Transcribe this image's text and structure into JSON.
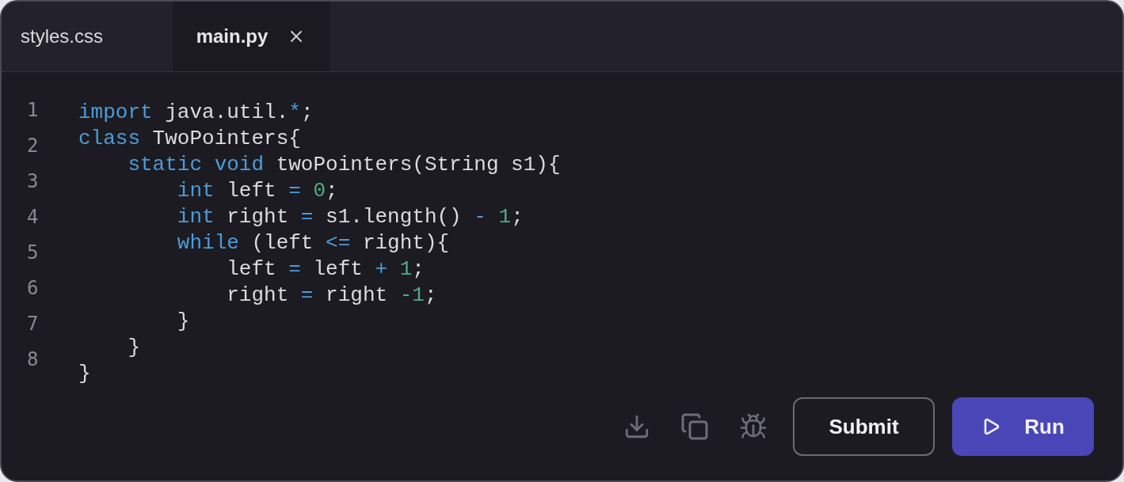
{
  "tabs": [
    {
      "label": "styles.css",
      "selected": false
    },
    {
      "label": "main.py",
      "selected": true
    }
  ],
  "line_numbers": [
    "1",
    "2",
    "3",
    "4",
    "5",
    "6",
    "7",
    "8"
  ],
  "code_lines": [
    [
      {
        "kind": "kw",
        "text": "import"
      },
      {
        "kind": "plain",
        "text": " java.util."
      },
      {
        "kind": "op",
        "text": "*"
      },
      {
        "kind": "plain",
        "text": ";"
      }
    ],
    [
      {
        "kind": "kw",
        "text": "class"
      },
      {
        "kind": "plain",
        "text": " TwoPointers{"
      }
    ],
    [
      {
        "kind": "kw",
        "text": "    static void"
      },
      {
        "kind": "plain",
        "text": " twoPointers(String s1){"
      }
    ],
    [
      {
        "kind": "kw",
        "text": "        int"
      },
      {
        "kind": "plain",
        "text": " left "
      },
      {
        "kind": "op",
        "text": "="
      },
      {
        "kind": "num",
        "text": " 0"
      },
      {
        "kind": "plain",
        "text": ";"
      }
    ],
    [
      {
        "kind": "kw",
        "text": "        int"
      },
      {
        "kind": "plain",
        "text": " right "
      },
      {
        "kind": "op",
        "text": "="
      },
      {
        "kind": "plain",
        "text": " s1.length() "
      },
      {
        "kind": "op",
        "text": "-"
      },
      {
        "kind": "num",
        "text": " 1"
      },
      {
        "kind": "plain",
        "text": ";"
      }
    ],
    [
      {
        "kind": "kw",
        "text": "        while"
      },
      {
        "kind": "plain",
        "text": " (left "
      },
      {
        "kind": "op",
        "text": "<="
      },
      {
        "kind": "plain",
        "text": " right){"
      }
    ],
    [
      {
        "kind": "plain",
        "text": "            left "
      },
      {
        "kind": "op",
        "text": "="
      },
      {
        "kind": "plain",
        "text": " left "
      },
      {
        "kind": "op",
        "text": "+"
      },
      {
        "kind": "num",
        "text": " 1"
      },
      {
        "kind": "plain",
        "text": ";"
      }
    ],
    [
      {
        "kind": "plain",
        "text": "            right "
      },
      {
        "kind": "op",
        "text": "="
      },
      {
        "kind": "plain",
        "text": " right "
      },
      {
        "kind": "num",
        "text": "-1"
      },
      {
        "kind": "plain",
        "text": ";"
      }
    ],
    [
      {
        "kind": "plain",
        "text": "        }"
      }
    ],
    [
      {
        "kind": "plain",
        "text": "    }"
      }
    ],
    [
      {
        "kind": "plain",
        "text": "}"
      }
    ]
  ],
  "buttons": [
    {
      "label": "Submit",
      "kind": "outline"
    },
    {
      "label": "Run",
      "kind": "primary"
    }
  ]
}
